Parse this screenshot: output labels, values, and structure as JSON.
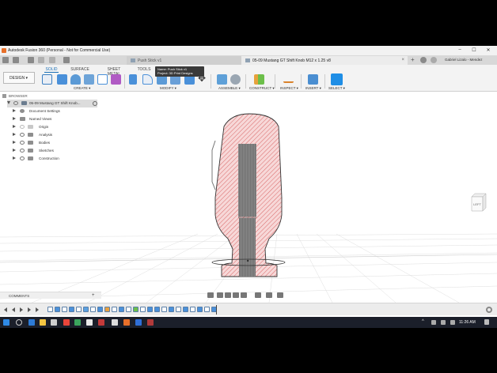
{
  "titlebar": {
    "title": "Autodesk Fusion 360 (Personal - Not for Commercial Use)",
    "minimize": "–",
    "maximize": "☐",
    "close": "✕"
  },
  "tabs": [
    {
      "label": "Push Stick v1",
      "active": false
    },
    {
      "label": "05-09 Mustang GT Shift Knob M12 x 1.25 v8",
      "active": true
    }
  ],
  "tab_close": "×",
  "tab_add": "+",
  "user_name": "Gabriel Lizalo - Mendez",
  "workspace": {
    "label": "DESIGN ▾"
  },
  "workspace_tabs": [
    "SOLID",
    "SURFACE",
    "SHEET METAL",
    "TOOLS"
  ],
  "groups": {
    "create": "CREATE ▾",
    "modify": "MODIFY ▾",
    "assemble": "ASSEMBLE ▾",
    "construct": "CONSTRUCT ▾",
    "inspect": "INSPECT ▾",
    "insert": "INSERT ▾",
    "select": "SELECT ▾"
  },
  "tooltip": {
    "line1": "Name: Push Stick v1",
    "line2": "Project: 3D Print Designs"
  },
  "browser": {
    "header": "BROWSER",
    "root": "05-09 Mustang GT Shift Knob...",
    "items": [
      "Document Settings",
      "Named Views",
      "Origin",
      "Analysis",
      "Bodies",
      "Sketches",
      "Construction"
    ]
  },
  "viewcube": {
    "face": "LEFT"
  },
  "comments": {
    "label": "COMMENTS",
    "add": "+"
  },
  "clock": "11:26 AM",
  "colors": {
    "accent": "#1a6fb6",
    "section_fill": "#f7d6d6",
    "hatch": "#d44",
    "taskbar": "#1b1f2a"
  }
}
